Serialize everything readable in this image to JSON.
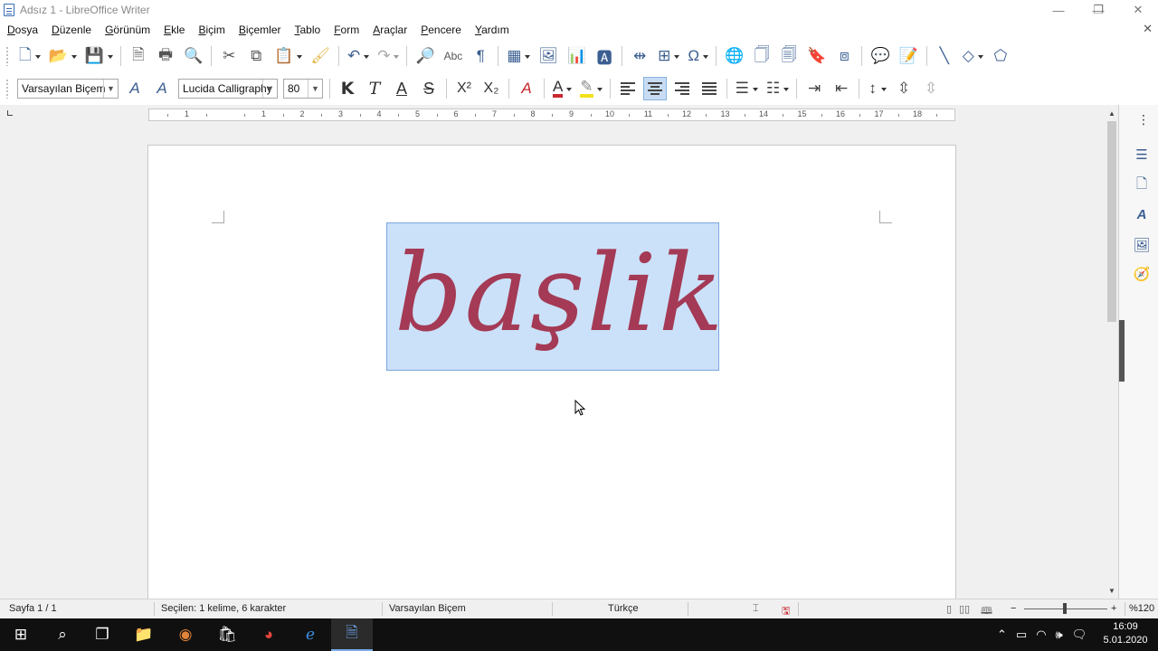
{
  "window": {
    "title": "Adsız 1 - LibreOffice Writer",
    "minimize": "—",
    "restore": "❐",
    "close": "✕",
    "doc_close": "✕"
  },
  "menu": [
    "Dosya",
    "Düzenle",
    "Görünüm",
    "Ekle",
    "Biçim",
    "Biçemler",
    "Tablo",
    "Form",
    "Araçlar",
    "Pencere",
    "Yardım"
  ],
  "formatting": {
    "paragraph_style": "Varsayılan Biçem",
    "font_name": "Lucida Calligraphy",
    "font_size": "80",
    "bold_glyph": "K",
    "italic_glyph": "T",
    "underline_glyph": "A",
    "strike_glyph": "S",
    "superscript_glyph": "X²",
    "subscript_glyph": "X₂"
  },
  "ruler": {
    "numbers": [
      "1",
      "1",
      "2",
      "3",
      "4",
      "5",
      "6",
      "7",
      "8",
      "9",
      "10",
      "11",
      "12",
      "13",
      "14",
      "15",
      "16",
      "17",
      "18"
    ]
  },
  "document": {
    "selected_text": "başlik"
  },
  "statusbar": {
    "page": "Sayfa 1 / 1",
    "selection": "Seçilen: 1 kelime, 6 karakter",
    "style": "Varsayılan Biçem",
    "language": "Türkçe",
    "zoom_minus": "−",
    "zoom_plus": "+",
    "zoom": "%120"
  },
  "taskbar": {
    "time": "16:09",
    "date": "5.01.2020"
  },
  "colors": {
    "accent": "#3c5f92",
    "selection_bg": "#cbe1f9",
    "text_color": "#a43a55",
    "font_color_bar": "#c8282f",
    "highlight_bar": "#f2e21d"
  }
}
